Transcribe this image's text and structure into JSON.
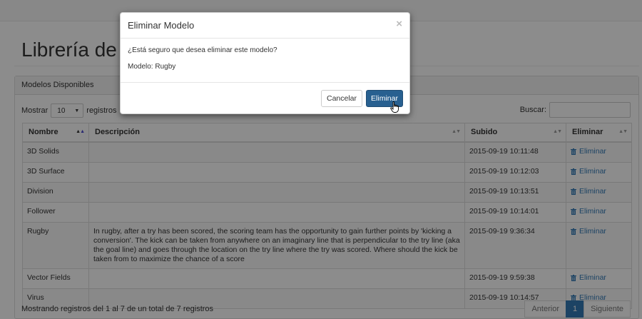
{
  "page": {
    "title": "Librería de modelos"
  },
  "panel": {
    "heading": "Modelos Disponibles",
    "length_prefix": "Mostrar",
    "length_value": "10",
    "length_suffix": "registros",
    "search_label": "Buscar:",
    "search_value": ""
  },
  "table": {
    "columns": [
      "Nombre",
      "Descripción",
      "Subido",
      "Eliminar"
    ],
    "rows": [
      {
        "name": "3D Solids",
        "description": "",
        "uploaded": "2015-09-19 10:11:48",
        "action": "Eliminar"
      },
      {
        "name": "3D Surface",
        "description": "",
        "uploaded": "2015-09-19 10:12:03",
        "action": "Eliminar"
      },
      {
        "name": "Division",
        "description": "",
        "uploaded": "2015-09-19 10:13:51",
        "action": "Eliminar"
      },
      {
        "name": "Follower",
        "description": "",
        "uploaded": "2015-09-19 10:14:01",
        "action": "Eliminar"
      },
      {
        "name": "Rugby",
        "description": "In rugby, after a try has been scored, the scoring team has the opportunity to gain further points by 'kicking a conversion'. The kick can be taken from anywhere on an imaginary line that is perpendicular to the try line (aka the goal line) and goes through the location on the try line where the try was scored. Where should the kick be taken from to maximize the chance of a score",
        "uploaded": "2015-09-19 9:36:34",
        "action": "Eliminar"
      },
      {
        "name": "Vector Fields",
        "description": "",
        "uploaded": "2015-09-19 9:59:38",
        "action": "Eliminar"
      },
      {
        "name": "Virus",
        "description": "",
        "uploaded": "2015-09-19 10:14:57",
        "action": "Eliminar"
      }
    ]
  },
  "footer": {
    "info": "Mostrando registros del 1 al 7 de un total de 7 registros",
    "prev": "Anterior",
    "current_page": "1",
    "next": "Siguiente"
  },
  "modal": {
    "title": "Eliminar Modelo",
    "close": "×",
    "question": "¿Está seguro que desea eliminar este modelo?",
    "model_label": "Modelo: Rugby",
    "cancel": "Cancelar",
    "confirm": "Eliminar"
  },
  "colors": {
    "primary": "#286090",
    "link": "#337ab7",
    "backdrop": "#000000"
  },
  "icons": {
    "delete": "trash-icon",
    "sort": "sort-icon",
    "close": "close-icon",
    "cursor": "hand-pointer-icon"
  }
}
